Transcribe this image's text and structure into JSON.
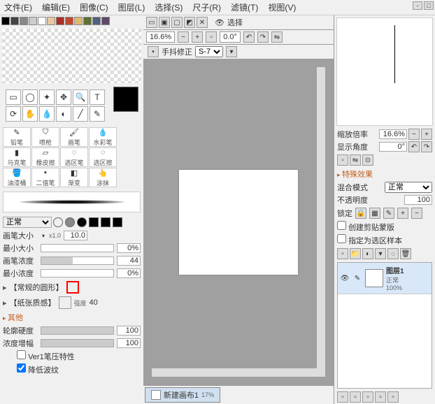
{
  "menu": {
    "file": "文件(E)",
    "edit": "编辑(E)",
    "image": "图像(C)",
    "layer": "图层(L)",
    "select": "选择(S)",
    "ruler": "尺子(R)",
    "filter": "滤镜(T)",
    "view": "视图(V)"
  },
  "selection_label": "选择",
  "canvas": {
    "zoom": "16.6%",
    "angle": "0.0°",
    "stabilizer_label": "手抖修正",
    "stabilizer_value": "S-7",
    "doc_name": "新建画布1",
    "doc_zoom": "17%"
  },
  "brush_tabs": [
    "铅笔",
    "喷枪",
    "画笔",
    "水彩笔",
    "马克笔",
    "橡皮擦",
    "选区笔",
    "选区擦",
    "油漆桶",
    "二值笔",
    "渐变",
    "涂抹"
  ],
  "mode_label": "正常",
  "size_mult": "x1.0",
  "params": {
    "brush_size_label": "画笔大小",
    "brush_size": "10.0",
    "min_size_label": "最小大小",
    "min_size": "0%",
    "density_label": "画笔浓度",
    "density": "44",
    "min_density_label": "最小浓度",
    "min_density": "0%"
  },
  "texture": {
    "shape_label": "【常规的圆形】",
    "paper_label": "【纸张质感】",
    "intensity_label": "强度",
    "intensity_val": "40"
  },
  "other_section": "其他",
  "edge_hardness_label": "轮廓硬度",
  "edge_hardness": "100",
  "density_boost_label": "浓度增幅",
  "density_boost": "100",
  "chk_ver1": "Ver1笔压特性",
  "chk_reduce": "降低波纹",
  "nav": {
    "zoom_label": "缩放倍率",
    "zoom_val": "16.6%",
    "angle_label": "显示角度",
    "angle_val": "0°"
  },
  "effects_section": "特殊效果",
  "blend_mode_label": "混合模式",
  "blend_mode_val": "正常",
  "opacity_label": "不透明度",
  "opacity_val": "100",
  "lock_label": "锁定",
  "clip_mask_label": "创建剪贴蒙版",
  "set_selection_label": "指定为选区样本",
  "layer": {
    "name": "图层1",
    "mode": "正常",
    "opacity": "100%"
  }
}
